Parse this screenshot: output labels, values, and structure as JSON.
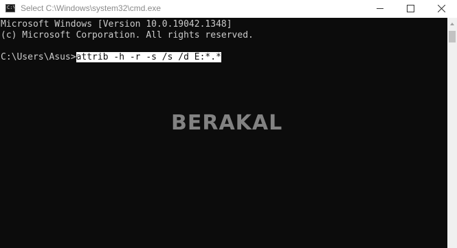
{
  "window": {
    "title": "Select C:\\Windows\\system32\\cmd.exe",
    "icon": "cmd-icon",
    "icon_text": "C:\\"
  },
  "console": {
    "lines": [
      "Microsoft Windows [Version 10.0.19042.1348]",
      "(c) Microsoft Corporation. All rights reserved."
    ],
    "prompt": "C:\\Users\\Asus>",
    "selected_command": "attrib -h -r -s /s /d E:*.*"
  },
  "watermark": "BERAKAL",
  "controls": {
    "minimize": "minimize-icon",
    "maximize": "maximize-icon",
    "close": "close-icon"
  }
}
